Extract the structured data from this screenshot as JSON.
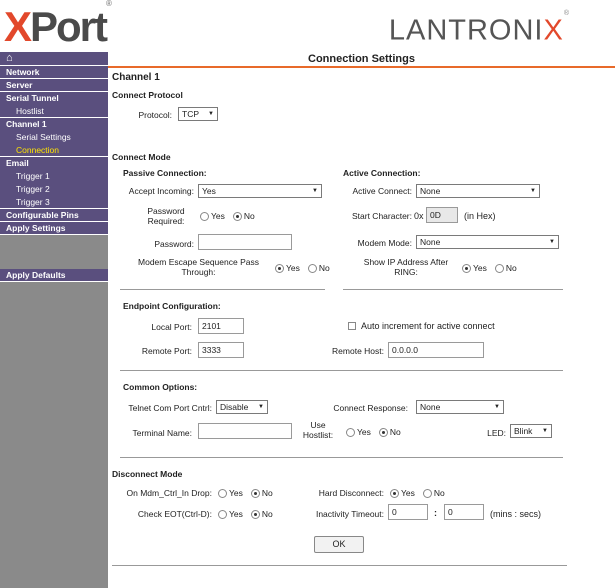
{
  "header": {
    "xport_logo_text_a": "X",
    "xport_logo_text_b": "Port",
    "xport_logo_mark": "®",
    "lantronix_logo_a": "LANTRONI",
    "lantronix_logo_b": "X",
    "lantronix_logo_mark": "®"
  },
  "sidebar": {
    "home_icon": "⌂",
    "network": "Network",
    "server": "Server",
    "serial_tunnel": "Serial Tunnel",
    "hostlist": "Hostlist",
    "channel1": "Channel 1",
    "serial_settings": "Serial Settings",
    "connection": "Connection",
    "email": "Email",
    "trigger1": "Trigger 1",
    "trigger2": "Trigger 2",
    "trigger3": "Trigger 3",
    "configurable_pins": "Configurable Pins",
    "apply_settings": "Apply Settings",
    "apply_defaults": "Apply Defaults"
  },
  "page": {
    "title": "Connection Settings",
    "channel": "Channel 1"
  },
  "protocol": {
    "section": "Connect Protocol",
    "label": "Protocol:",
    "value": "TCP"
  },
  "connect_mode": {
    "section": "Connect Mode",
    "passive_title": "Passive Connection:",
    "accept_incoming_label": "Accept Incoming:",
    "accept_incoming_value": "Yes",
    "password_required_label_a": "Password",
    "password_required_label_b": "Required:",
    "password_label": "Password:",
    "password_value": "",
    "modem_escape_label_a": "Modem Escape Sequence Pass",
    "modem_escape_label_b": "Through:",
    "active_title": "Active Connection:",
    "active_connect_label": "Active Connect:",
    "active_connect_value": "None",
    "start_char_label": "Start Character:",
    "start_char_prefix": "0x",
    "start_char_value": "0D",
    "start_char_suffix": "(in Hex)",
    "modem_mode_label": "Modem Mode:",
    "modem_mode_value": "None",
    "show_ip_label_a": "Show IP Address After",
    "show_ip_label_b": "RING:"
  },
  "radio": {
    "yes": "Yes",
    "no": "No"
  },
  "endpoint": {
    "title": "Endpoint Configuration:",
    "local_port_label": "Local Port:",
    "local_port_value": "2101",
    "auto_increment_label": "Auto increment for active connect",
    "remote_port_label": "Remote Port:",
    "remote_port_value": "3333",
    "remote_host_label": "Remote Host:",
    "remote_host_value": "0.0.0.0"
  },
  "common": {
    "title": "Common Options:",
    "telnet_label": "Telnet Com Port Cntrl:",
    "telnet_value": "Disable",
    "connect_response_label": "Connect Response:",
    "connect_response_value": "None",
    "terminal_name_label": "Terminal Name:",
    "terminal_name_value": "",
    "use_hostlist_label_a": "Use",
    "use_hostlist_label_b": "Hostlist:",
    "led_label": "LED:",
    "led_value": "Blink"
  },
  "disconnect": {
    "section": "Disconnect Mode",
    "on_mdm_label": "On Mdm_Ctrl_In Drop:",
    "hard_disconnect_label": "Hard Disconnect:",
    "check_eot_label": "Check EOT(Ctrl-D):",
    "inactivity_label": "Inactivity Timeout:",
    "inactivity_min": "0",
    "inactivity_colon": ":",
    "inactivity_sec": "0",
    "inactivity_units": "(mins : secs)"
  },
  "ok_button": "OK",
  "colors": {
    "accent": "#e86a2a",
    "sidebar": "#8a8a8a",
    "nav": "#5a4f7e",
    "active_nav": "#ffe400"
  }
}
